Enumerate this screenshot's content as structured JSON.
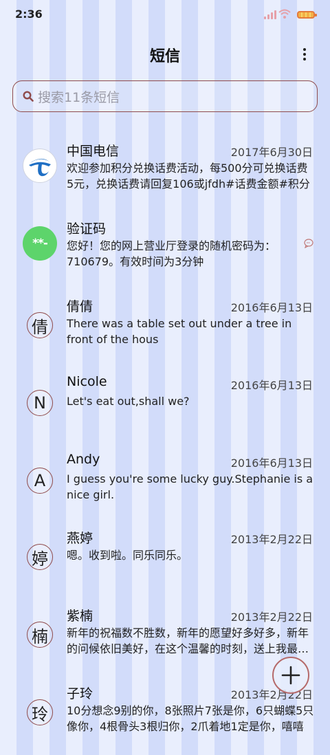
{
  "status": {
    "time": "2:36"
  },
  "header": {
    "title": "短信"
  },
  "search": {
    "placeholder": "搜索11条短信"
  },
  "avatars": {
    "code_text": "**-"
  },
  "messages": [
    {
      "name": "中国电信",
      "date": "2017年6月30日",
      "preview": "欢迎参加积分兑换话费活动，每500分可兑换话费5元，兑换话费请回复106或jfdh#话费金额#积分",
      "avatar": "telecom-logo-icon"
    },
    {
      "name": "验证码",
      "date": "",
      "preview": "您好！您的网上营业厅登录的随机密码为：710679。有效时间为3分钟",
      "avatar": "code"
    },
    {
      "name": "倩倩",
      "date": "2016年6月13日",
      "preview": "There was a table set out under a tree in front of the hous",
      "avatar_letter": "倩"
    },
    {
      "name": "Nicole",
      "date": "2016年6月13日",
      "preview": "Let's eat out,shall we?",
      "avatar_letter": "N"
    },
    {
      "name": "Andy",
      "date": "2016年6月13日",
      "preview": "I guess you're some lucky guy.Stephanie is a nice girl.",
      "avatar_letter": "A"
    },
    {
      "name": "燕婷",
      "date": "2013年2月22日",
      "preview": "嗯。收到啦。同乐同乐。",
      "avatar_letter": "婷"
    },
    {
      "name": "紫楠",
      "date": "2013年2月22日",
      "preview": "新年的祝福数不胜数，新年的愿望好多好多，新年的问候依旧美好，在这个温馨的时刻，送上我最真挚的祝福",
      "avatar_letter": "楠"
    },
    {
      "name": "子玲",
      "date": "2013年2月22日",
      "preview": "10分想念9别的你，8张照片7张是你，6只蝴蝶5只像你，4根骨头3根归你，2爪着地1定是你，嘻嘻",
      "avatar_letter": "玲"
    }
  ]
}
